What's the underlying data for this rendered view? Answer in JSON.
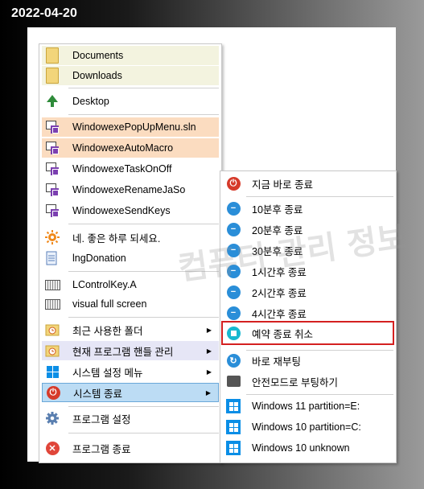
{
  "date": "2022-04-20",
  "watermark": "컴퓨터 관리 정보",
  "menu": {
    "items": [
      {
        "label": "Documents",
        "icon": "folder-icon"
      },
      {
        "label": "Downloads",
        "icon": "folder-icon"
      },
      {
        "label": "Desktop",
        "icon": "desktop-tree-icon"
      },
      {
        "label": "WindowexePopUpMenu.sln",
        "icon": "visual-studio-icon"
      },
      {
        "label": "WindowexeAutoMacro",
        "icon": "visual-studio-icon"
      },
      {
        "label": "WindowexeTaskOnOff",
        "icon": "visual-studio-icon"
      },
      {
        "label": "WindowexeRenameJaSo",
        "icon": "visual-studio-icon"
      },
      {
        "label": "WindowexeSendKeys",
        "icon": "visual-studio-icon"
      },
      {
        "label": "네. 좋은 하루 되세요.",
        "icon": "sun-gear-icon"
      },
      {
        "label": "lngDonation",
        "icon": "document-icon"
      },
      {
        "label": "LControlKey.A",
        "icon": "keyboard-icon"
      },
      {
        "label": "visual full screen",
        "icon": "keyboard-icon"
      },
      {
        "label": "최근 사용한 폴더",
        "icon": "recent-folder-icon"
      },
      {
        "label": "현재 프로그램 핸들 관리",
        "icon": "recent-folder-icon"
      },
      {
        "label": "시스템 설정 메뉴",
        "icon": "windows-icon"
      },
      {
        "label": "시스템 종료",
        "icon": "power-icon"
      },
      {
        "label": "프로그램 설정",
        "icon": "gear-icon"
      },
      {
        "label": "프로그램 종료",
        "icon": "close-icon"
      }
    ]
  },
  "submenu": {
    "items": [
      {
        "label": "지금 바로 종료",
        "icon": "power-icon"
      },
      {
        "label": "10분후 종료",
        "icon": "timer-icon"
      },
      {
        "label": "20분후 종료",
        "icon": "timer-icon"
      },
      {
        "label": "30분후 종료",
        "icon": "timer-icon"
      },
      {
        "label": "1시간후 종료",
        "icon": "timer-icon"
      },
      {
        "label": "2시간후 종료",
        "icon": "timer-icon"
      },
      {
        "label": "4시간후 종료",
        "icon": "timer-icon"
      },
      {
        "label": "예약 종료 취소",
        "icon": "stop-icon"
      },
      {
        "label": "바로 재부팅",
        "icon": "reboot-icon"
      },
      {
        "label": "안전모드로 부팅하기",
        "icon": "safe-mode-icon"
      },
      {
        "label": "Windows 11  partition=E:",
        "icon": "windows-icon"
      },
      {
        "label": "Windows 10  partition=C:",
        "icon": "windows-icon"
      },
      {
        "label": "Windows 10  unknown",
        "icon": "windows-icon"
      }
    ]
  },
  "colors": {
    "folder_row_bg": "#f3f3df",
    "vs_row_bg": "#fbdcc0",
    "hover_bg": "#e6e6f6",
    "selected_bg": "#bcdcf4",
    "selected_border": "#6aa8d8",
    "highlight_border": "#d42020",
    "timer_icon": "#2a8ed8",
    "stop_icon": "#18b8d0",
    "power_icon": "#d63a2a"
  }
}
